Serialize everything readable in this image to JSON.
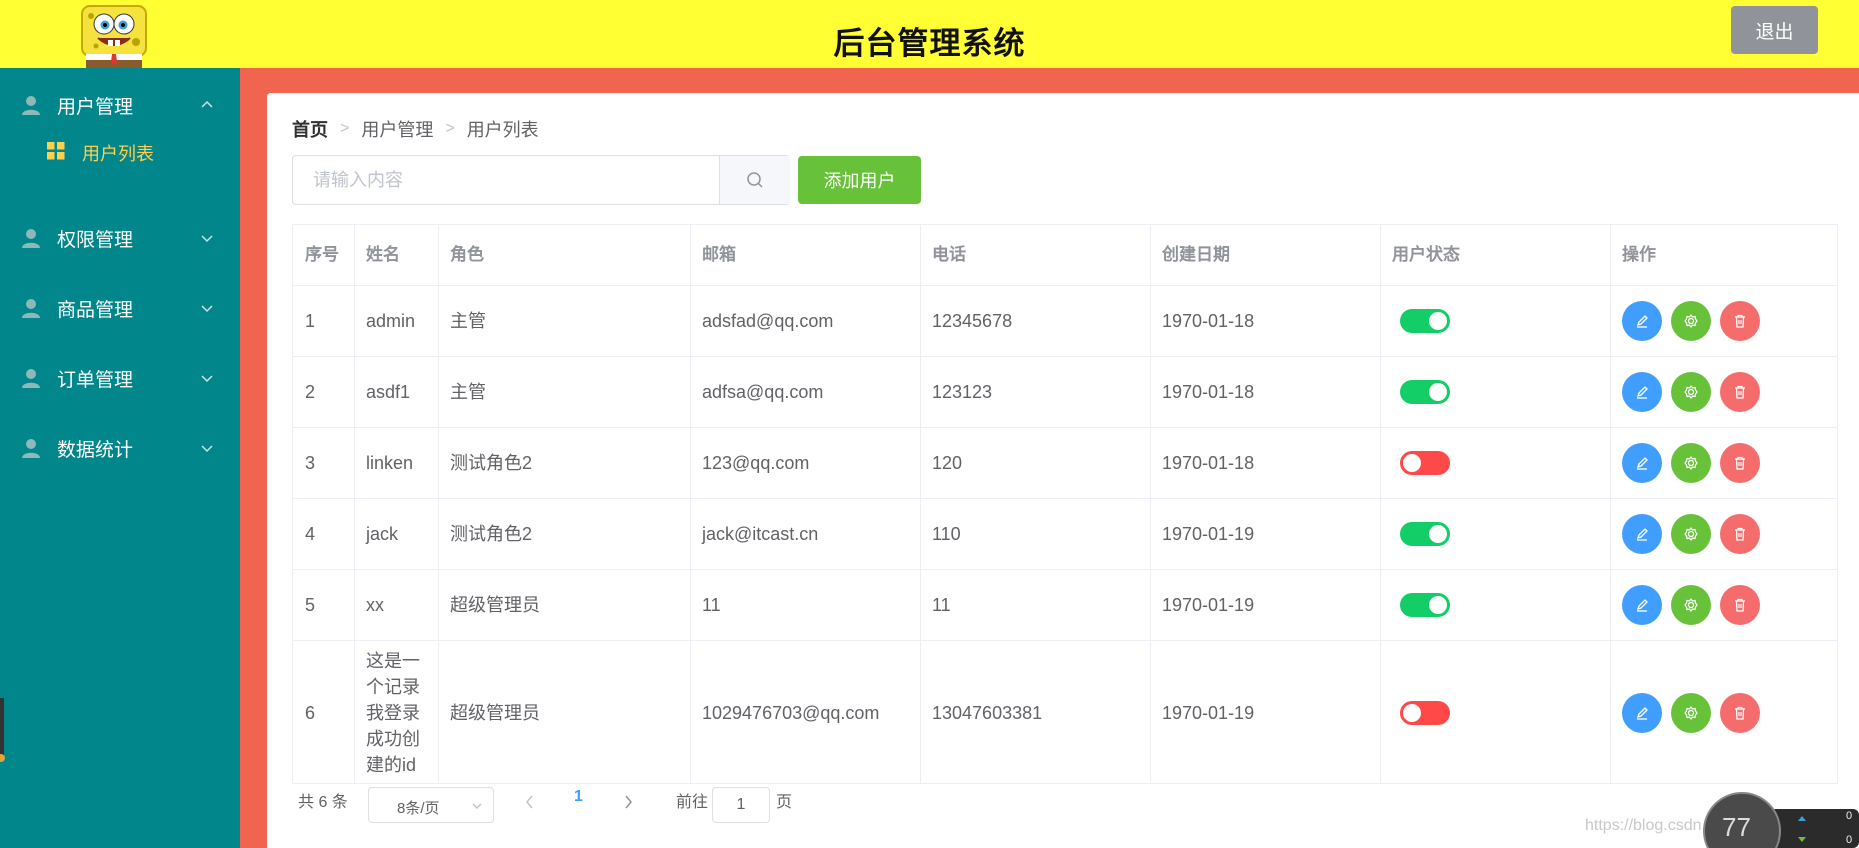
{
  "header": {
    "title": "后台管理系统",
    "logout_label": "退出"
  },
  "sidebar": {
    "menus": [
      {
        "label": "用户管理",
        "icon": "user-icon",
        "expanded": true
      },
      {
        "label": "权限管理",
        "icon": "user-icon",
        "expanded": false
      },
      {
        "label": "商品管理",
        "icon": "user-icon",
        "expanded": false
      },
      {
        "label": "订单管理",
        "icon": "user-icon",
        "expanded": false
      },
      {
        "label": "数据统计",
        "icon": "user-icon",
        "expanded": false
      }
    ],
    "sub_item": {
      "label": "用户列表",
      "icon": "grid-icon",
      "active": true
    },
    "colors": {
      "background": "#00868b",
      "text": "#ffffff",
      "active_text": "#ffd04b"
    }
  },
  "breadcrumb": {
    "home": "首页",
    "level1": "用户管理",
    "level2": "用户列表"
  },
  "search": {
    "placeholder": "请输入内容",
    "value": "",
    "icon": "search-icon"
  },
  "add_user_label": "添加用户",
  "table": {
    "headers": [
      "序号",
      "姓名",
      "角色",
      "邮箱",
      "电话",
      "创建日期",
      "用户状态",
      "操作"
    ],
    "rows": [
      {
        "index": "1",
        "name": "admin",
        "role": "主管",
        "email": "adsfad@qq.com",
        "phone": "12345678",
        "created": "1970-01-18",
        "status": true
      },
      {
        "index": "2",
        "name": "asdf1",
        "role": "主管",
        "email": "adfsa@qq.com",
        "phone": "123123",
        "created": "1970-01-18",
        "status": true
      },
      {
        "index": "3",
        "name": "linken",
        "role": "测试角色2",
        "email": "123@qq.com",
        "phone": "120",
        "created": "1970-01-18",
        "status": false
      },
      {
        "index": "4",
        "name": "jack",
        "role": "测试角色2",
        "email": "jack@itcast.cn",
        "phone": "110",
        "created": "1970-01-19",
        "status": true
      },
      {
        "index": "5",
        "name": "xx",
        "role": "超级管理员",
        "email": "11",
        "phone": "11",
        "created": "1970-01-19",
        "status": true
      },
      {
        "index": "6",
        "name": "这是一个记录我登录成功创建的id",
        "role": "超级管理员",
        "email": "1029476703@qq.com",
        "phone": "13047603381",
        "created": "1970-01-19",
        "status": false
      }
    ],
    "action_icons": [
      "edit-icon",
      "setting-icon",
      "delete-icon"
    ]
  },
  "pagination": {
    "total_label": "共 6 条",
    "page_size_label": "8条/页",
    "current_page": "1",
    "goto_label": "前往",
    "goto_value": "1",
    "page_suffix": "页"
  },
  "watermark": "https://blog.csdn.net/weixin_43503511",
  "net_widget": {
    "value": "77",
    "up": "0",
    "down": "0"
  },
  "colors": {
    "header_bg": "#ffff33",
    "main_bg": "#f06450",
    "primary": "#409eff",
    "success": "#67c23a",
    "danger": "#f56c6c",
    "switch_on": "#13ce66",
    "switch_off": "#ff4949",
    "logout_bg": "#909399"
  }
}
